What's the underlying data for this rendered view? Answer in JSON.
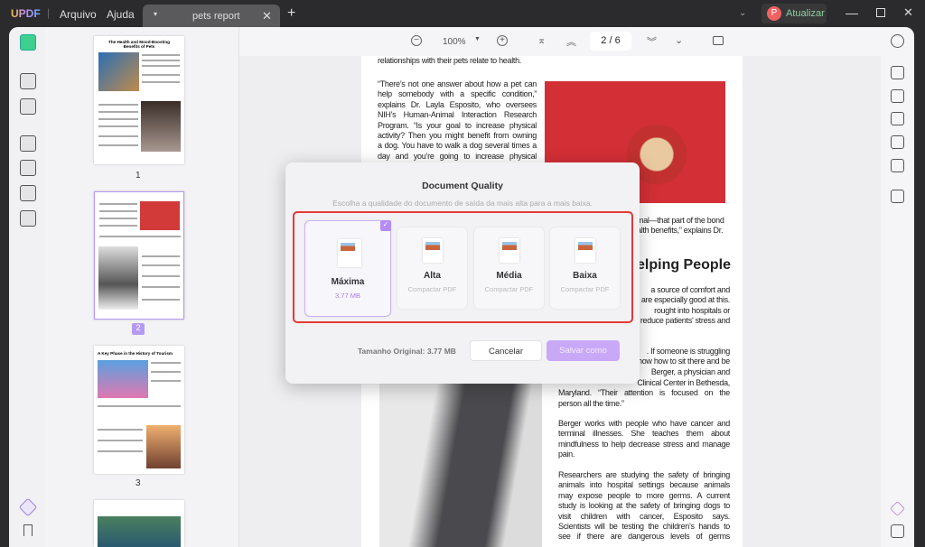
{
  "app": {
    "logo": "UPDF",
    "menu": [
      "Arquivo",
      "Ajuda"
    ],
    "tab_title": "pets report",
    "upgrade": "Atualizar",
    "avatar_letter": "P"
  },
  "toolbar": {
    "zoom": "100%",
    "page_current": "2",
    "page_sep": "/",
    "page_total": "6"
  },
  "thumbnails": {
    "labels": [
      "1",
      "2",
      "3"
    ],
    "titles": [
      "The Health and Mood-Boosting Benefits of Pets",
      "A Key Phase in the History of Tourism"
    ]
  },
  "page": {
    "p0": "relationships with their pets relate to health.",
    "p1": [
      "“There’s not one answer about how a pet can",
      "help somebody with a specific condition,”",
      "explains Dr. Layla Esposito, who oversees",
      "NIH’s Human-Animal Interaction Research",
      "Program. “Is your goal to increase physical",
      "activity? Then you might benefit from owning",
      "a dog. You have to walk a dog several times a",
      "day and you’re going to increase physical"
    ],
    "frag1": [
      "mal—that part of the bond",
      "alth benefits,” explains Dr."
    ],
    "heading": "elping People",
    "frag2": [
      "a source of comfort and",
      "are especially good at this.",
      "rought into hospitals or",
      "reduce patients’ stress and"
    ],
    "frag3": [
      ". If someone is struggling",
      "how how to sit there and be",
      "Berger, a physician and"
    ],
    "p2": [
      "Clinical Center in Bethesda,",
      "Maryland. “Their attention is focused on the",
      "person all the time.”"
    ],
    "p3": [
      "Berger works with people who have cancer and",
      "terminal illnesses. She teaches them about",
      "mindfulness to help decrease stress and manage",
      "pain."
    ],
    "p4": [
      "Researchers are studying the safety of bringing",
      "animals into hospital settings because animals",
      "may expose people to more germs. A current",
      "study is looking at the safety of bringing dogs to",
      "visit children with cancer, Esposito says.",
      "Scientists will be testing the children’s hands to",
      "see if there are dangerous levels of germs"
    ]
  },
  "dialog": {
    "title": "Document Quality",
    "subtitle": "Escolha a qualidade do documento de saída da mais alta para a mais baixa.",
    "options": [
      {
        "title": "Máxima",
        "sub": "3.77 MB",
        "selected": true
      },
      {
        "title": "Alta",
        "sub": "Compactar PDF"
      },
      {
        "title": "Média",
        "sub": "Compactar PDF"
      },
      {
        "title": "Baixa",
        "sub": "Compactar PDF"
      }
    ],
    "original_size": "Tamanho Original: 3.77 MB",
    "cancel": "Cancelar",
    "save": "Salvar como",
    "accent": "#b58cf5",
    "highlight": "#e53935"
  }
}
